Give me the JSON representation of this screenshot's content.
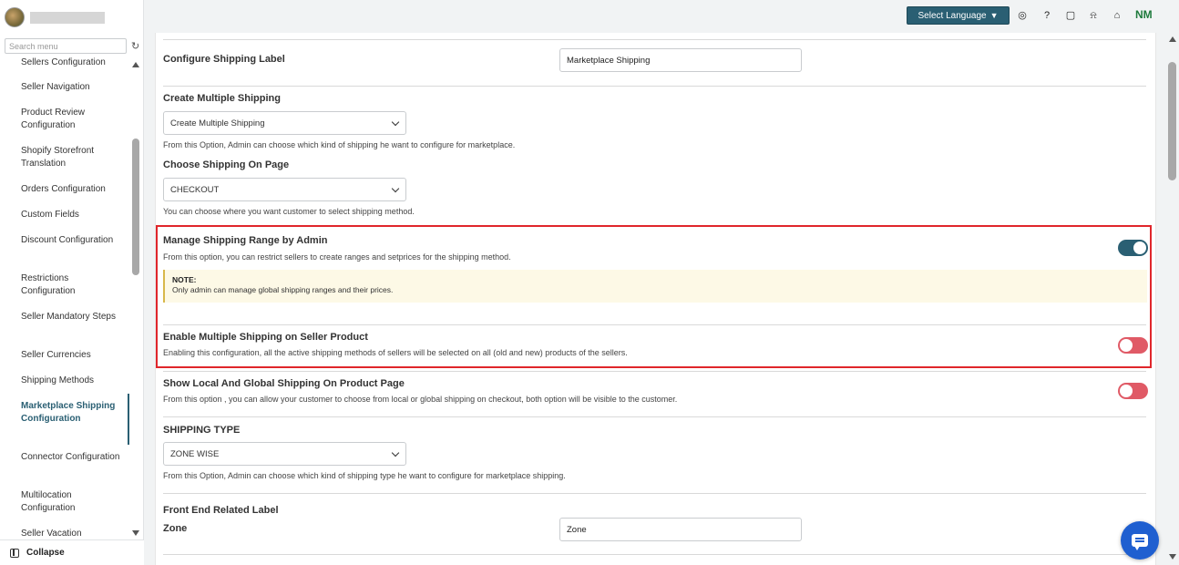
{
  "sidebar": {
    "search_placeholder": "Search menu",
    "collapse_label": "Collapse",
    "items": [
      {
        "label": "Sellers Configuration"
      },
      {
        "label": "Seller Navigation"
      },
      {
        "label": "Product Review Configuration"
      },
      {
        "label": "Shopify Storefront Translation"
      },
      {
        "label": "Orders Configuration"
      },
      {
        "label": "Custom Fields"
      },
      {
        "label": "Discount Configuration"
      },
      {
        "label": "Restrictions Configuration"
      },
      {
        "label": "Seller Mandatory Steps"
      },
      {
        "label": "Seller Currencies"
      },
      {
        "label": "Shipping Methods"
      },
      {
        "label": "Marketplace Shipping Configuration"
      },
      {
        "label": "Connector Configuration"
      },
      {
        "label": "Multilocation Configuration"
      },
      {
        "label": "Seller Vacation"
      }
    ],
    "active_item": "Marketplace Shipping Configuration"
  },
  "topbar": {
    "language_button": "Select Language",
    "icons": [
      "account-circle-icon",
      "help-icon",
      "feedback-icon",
      "bell-icon",
      "store-icon"
    ],
    "avatar_initials": "NM"
  },
  "form": {
    "shipping_label": {
      "label": "Configure Shipping Label",
      "value": "Marketplace Shipping"
    },
    "multiple_shipping": {
      "label": "Create Multiple Shipping",
      "selected": "Create Multiple Shipping",
      "help": "From this Option, Admin can choose which kind of shipping he want to configure for marketplace."
    },
    "shipping_on_page": {
      "label": "Choose Shipping On Page",
      "selected": "CHECKOUT",
      "help": "You can choose where you want customer to select shipping method."
    },
    "manage_range": {
      "label": "Manage Shipping Range by Admin",
      "help": "From this option, you can restrict sellers to create ranges and setprices for the shipping method.",
      "enabled": true,
      "note_title": "NOTE:",
      "note_text": "Only admin can manage global shipping ranges and their prices."
    },
    "multi_seller_product": {
      "label": "Enable Multiple Shipping on Seller Product",
      "help": "Enabling this configuration, all the active shipping methods of sellers will be selected on all (old and new) products of the sellers.",
      "enabled": false
    },
    "local_global": {
      "label": "Show Local And Global Shipping On Product Page",
      "help": "From this option , you can allow your customer to choose from local or global shipping on checkout, both option will be visible to the customer.",
      "enabled": false
    },
    "shipping_type": {
      "label": "SHIPPING TYPE",
      "selected": "ZONE WISE",
      "help": "From this Option, Admin can choose which kind of shipping type he want to configure for marketplace shipping."
    },
    "front_end": {
      "section_label": "Front End Related Label",
      "zone_label": "Zone",
      "zone_value": "Zone"
    }
  },
  "colors": {
    "accent": "#2a5f73",
    "toggle_off": "#e05a66",
    "highlight_border": "#e0262b",
    "chat_button": "#1f5fd0"
  }
}
